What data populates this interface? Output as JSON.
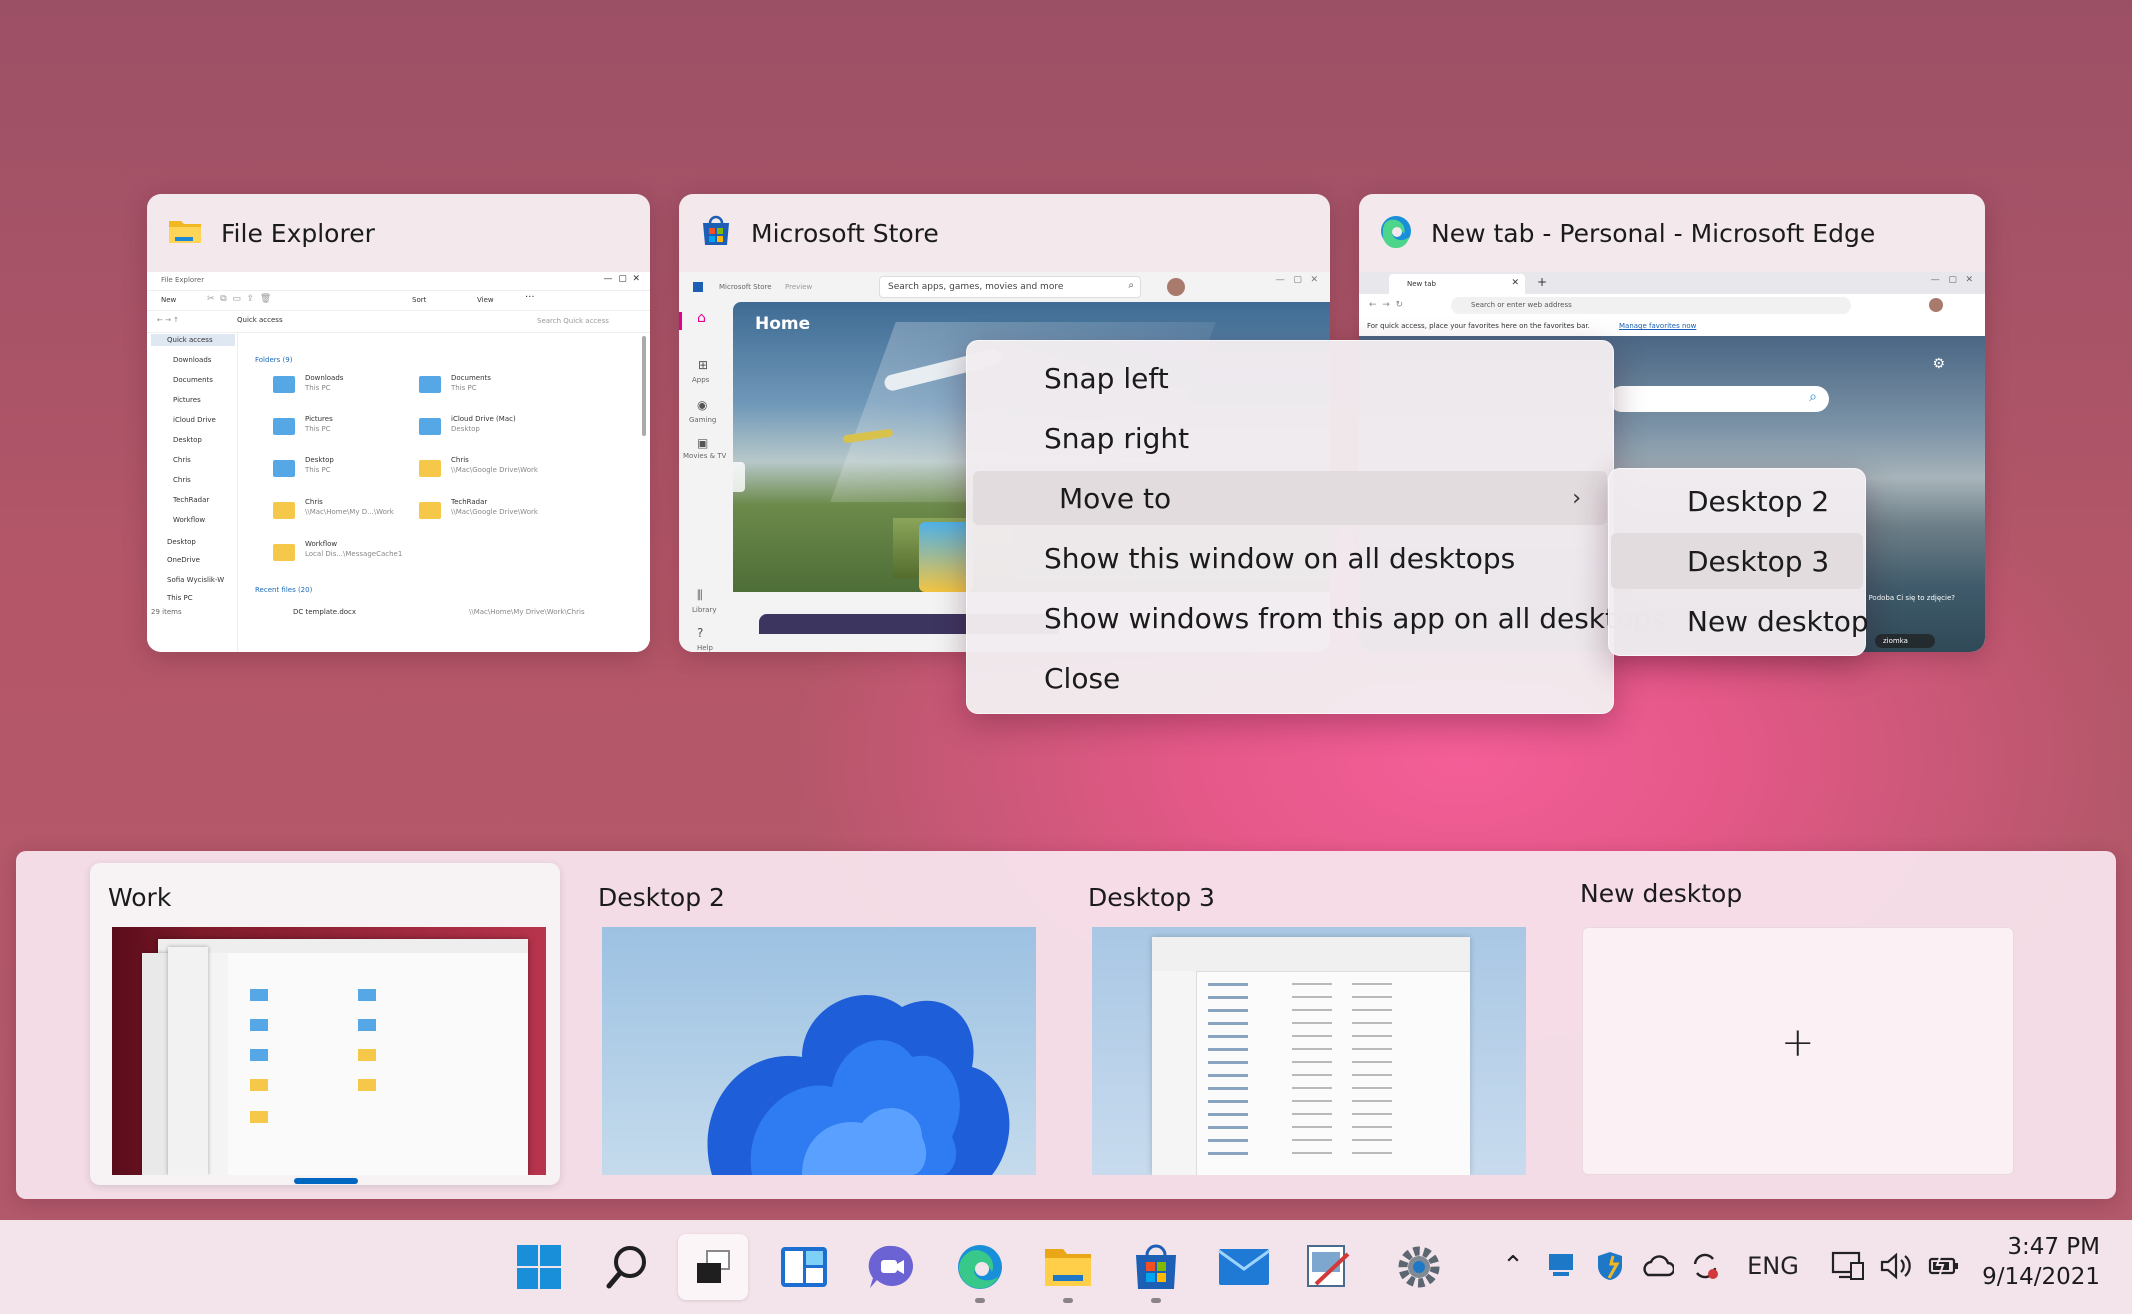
{
  "windows": [
    {
      "title": "File Explorer",
      "icon": "folder-icon"
    },
    {
      "title": "Microsoft Store",
      "icon": "store-icon"
    },
    {
      "title": "New tab - Personal - Microsoft Edge",
      "icon": "edge-icon"
    }
  ],
  "file_explorer": {
    "app_title": "File Explorer",
    "toolbar": [
      "New",
      "Sort",
      "View"
    ],
    "address": "Quick access",
    "search_placeholder": "Search Quick access",
    "nav": [
      "Quick access",
      "Downloads",
      "Documents",
      "Pictures",
      "iCloud Drive",
      "Desktop",
      "Chris",
      "Chris",
      "TechRadar",
      "Workflow",
      "Desktop",
      "OneDrive",
      "Sofia Wycislik-W",
      "This PC"
    ],
    "folders_header": "Folders (9)",
    "folders": [
      {
        "name": "Downloads",
        "sub": "This PC"
      },
      {
        "name": "Documents",
        "sub": "This PC"
      },
      {
        "name": "Pictures",
        "sub": "This PC"
      },
      {
        "name": "iCloud Drive (Mac)",
        "sub": "Desktop"
      },
      {
        "name": "Desktop",
        "sub": "This PC"
      },
      {
        "name": "Chris",
        "sub": "\\\\Mac\\Google Drive\\Work"
      },
      {
        "name": "Chris",
        "sub": "\\\\Mac\\Home\\My D...\\Work"
      },
      {
        "name": "TechRadar",
        "sub": "\\\\Mac\\Google Drive\\Work"
      },
      {
        "name": "Workflow",
        "sub": "Local Dis...\\MessageCache1"
      }
    ],
    "recent_header": "Recent files (20)",
    "recent_file": "DC template.docx",
    "recent_path": "\\\\Mac\\Home\\My Drive\\Work\\Chris",
    "status": "29 items"
  },
  "store": {
    "app_title": "Microsoft Store",
    "app_title_suffix": "Preview",
    "search_placeholder": "Search apps, games, movies and more",
    "home_label": "Home",
    "nav": [
      "Apps",
      "Gaming",
      "Movies & TV",
      "Library",
      "Help"
    ]
  },
  "edge": {
    "tab_label": "New tab",
    "address_placeholder": "Search or enter web address",
    "favorites_hint": "For quick access, place your favorites here on the favorites bar.",
    "favorites_link": "Manage favorites now",
    "caption": "Podoba Ci się to zdjęcie?",
    "chip": "ziomka"
  },
  "context_menu": {
    "items": [
      "Snap left",
      "Snap right",
      "Move to",
      "Show this window on all desktops",
      "Show windows from this app on all desktops",
      "Close"
    ],
    "highlighted": "Move to",
    "submenu": [
      "Desktop 2",
      "Desktop 3",
      "New desktop"
    ],
    "submenu_highlighted": "Desktop 3"
  },
  "desktops": [
    {
      "label": "Work",
      "active": true
    },
    {
      "label": "Desktop 2",
      "active": false
    },
    {
      "label": "Desktop 3",
      "active": false
    },
    {
      "label": "New desktop",
      "active": false
    }
  ],
  "taskbar": {
    "apps": [
      "start-icon",
      "search-icon",
      "task-view-icon",
      "widgets-icon",
      "teams-chat-icon",
      "edge-icon",
      "file-explorer-icon",
      "store-icon",
      "mail-icon",
      "snipping-tool-icon",
      "settings-icon"
    ],
    "tray": {
      "language": "ENG",
      "time": "3:47 PM",
      "date": "9/14/2021"
    }
  },
  "colors": {
    "accent": "#0067c0",
    "menu_bg": "#f2ecf0",
    "highlight": "#e2dcdf"
  }
}
